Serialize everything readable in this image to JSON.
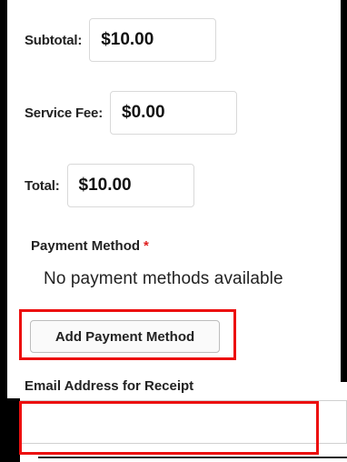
{
  "summary": {
    "subtotal": {
      "label": "Subtotal:",
      "value": "$10.00"
    },
    "service_fee": {
      "label": "Service Fee:",
      "value": "$0.00"
    },
    "total": {
      "label": "Total:",
      "value": "$10.00"
    }
  },
  "payment": {
    "label": "Payment Method",
    "required_mark": "*",
    "empty_message": "No payment methods available",
    "add_button_label": "Add Payment Method"
  },
  "email": {
    "label": "Email Address for Receipt",
    "value": ""
  },
  "colors": {
    "highlight": "#ec0f0f",
    "required": "#e02020"
  }
}
